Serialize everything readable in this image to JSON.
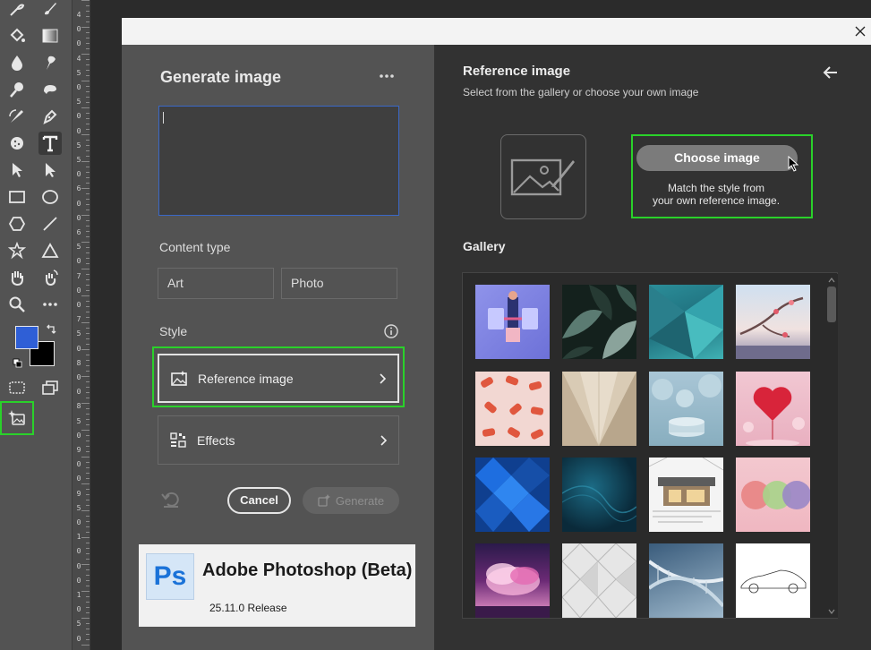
{
  "toolbar": {
    "tools": [
      "healing-brush-icon",
      "brush-icon",
      "paint-bucket-icon",
      "gradient-icon",
      "blur-icon",
      "smudge-icon",
      "dodge-icon",
      "burn-icon",
      "history-brush-icon",
      "pen-icon",
      "sponge-icon",
      "type-icon",
      "path-selection-icon",
      "direct-selection-icon",
      "rectangle-icon",
      "ellipse-icon",
      "polygon-icon",
      "line-icon",
      "custom-shape-icon",
      "triangle-icon",
      "hand-icon",
      "rotate-view-icon",
      "zoom-icon",
      "more-tools-icon"
    ],
    "foreground_color": "#2f5fd6",
    "background_color": "#000000"
  },
  "ruler": {
    "digits": [
      "4",
      "0",
      "0",
      "4",
      "5",
      "0",
      "5",
      "0",
      "0",
      "5",
      "5",
      "0",
      "6",
      "0",
      "0",
      "6",
      "5",
      "0",
      "7",
      "0",
      "0",
      "7",
      "5",
      "0",
      "8",
      "0",
      "0",
      "8",
      "5",
      "0",
      "9",
      "0",
      "0",
      "9",
      "5",
      "0",
      "1",
      "0",
      "0",
      "0",
      "1",
      "0",
      "5",
      "0"
    ]
  },
  "dialog": {
    "left": {
      "title": "Generate image",
      "prompt_value": "",
      "content_type_label": "Content type",
      "content_types": [
        "Art",
        "Photo"
      ],
      "style_label": "Style",
      "reference_image_label": "Reference image",
      "effects_label": "Effects",
      "cancel_label": "Cancel",
      "generate_label": "Generate"
    },
    "splash": {
      "logo_text": "Ps",
      "app_name": "Adobe Photoshop (Beta)",
      "version": "25.11.0 Release"
    },
    "right": {
      "title": "Reference image",
      "subtitle": "Select from the gallery or choose your own image",
      "choose_button": "Choose image",
      "choose_desc_line1": "Match the style from",
      "choose_desc_line2": "your own reference image.",
      "gallery_title": "Gallery",
      "gallery_items": [
        "abstract-figure-illustration",
        "tropical-leaves",
        "teal-geometric",
        "blossom-branch",
        "red-hands-pattern",
        "beige-paper-folds",
        "teal-podium-flowers",
        "red-heart-balloons",
        "blue-cubes",
        "dark-teal-waves",
        "modern-house-sketch",
        "pastel-spheres",
        "pink-clouds",
        "white-triangles",
        "dna-helix",
        "car-line-sketch"
      ]
    }
  },
  "colors": {
    "highlight": "#2ad12a",
    "accent_blue": "#3a68c7"
  }
}
